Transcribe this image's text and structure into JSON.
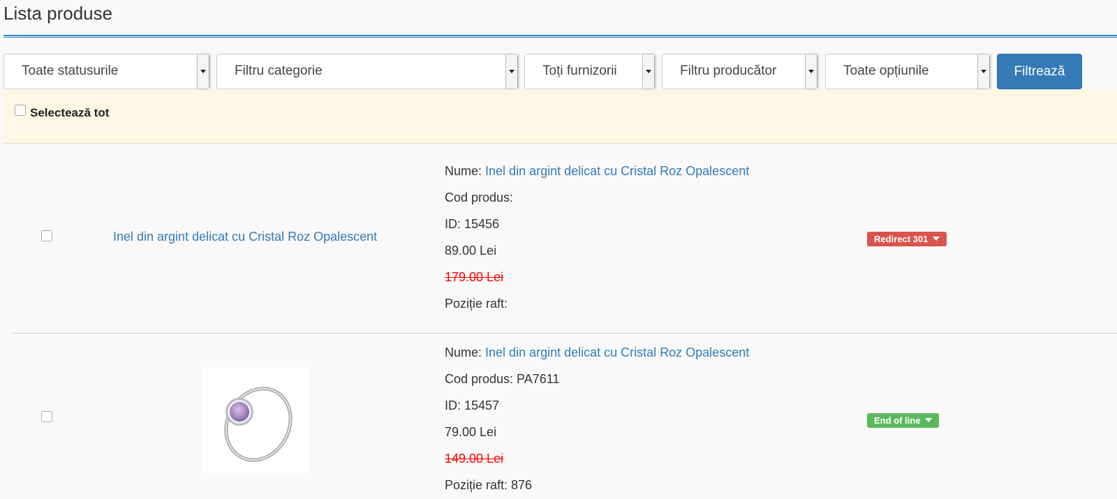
{
  "page": {
    "title": "Lista produse"
  },
  "filters": {
    "status": "Toate statusurile",
    "category": "Filtru categorie",
    "supplier": "Toți furnizorii",
    "manufacturer": "Filtru producător",
    "options": "Toate opțiunile",
    "submit": "Filtrează"
  },
  "select_all": {
    "label": "Selectează tot"
  },
  "products": [
    {
      "title_link": "Inel din argint delicat cu Cristal Roz Opalescent",
      "name_label": "Nume:",
      "name": "Inel din argint delicat cu Cristal Roz Opalescent",
      "code": "Cod produs:",
      "id": "ID: 15456",
      "price": "89.00 Lei",
      "old_price": "179.00 Lei",
      "shelf": "Poziție raft:",
      "status": "Redirect 301",
      "status_color": "#d9534f"
    },
    {
      "image": "ring-thumbnail",
      "name_label": "Nume:",
      "name": "Inel din argint delicat cu Cristal Roz Opalescent",
      "code": "Cod produs: PA7611",
      "id": "ID: 15457",
      "price": "79.00 Lei",
      "old_price": "149.00 Lei",
      "shelf": "Poziție raft: 876",
      "status": "End of line",
      "status_color": "#5cb85c"
    }
  ]
}
